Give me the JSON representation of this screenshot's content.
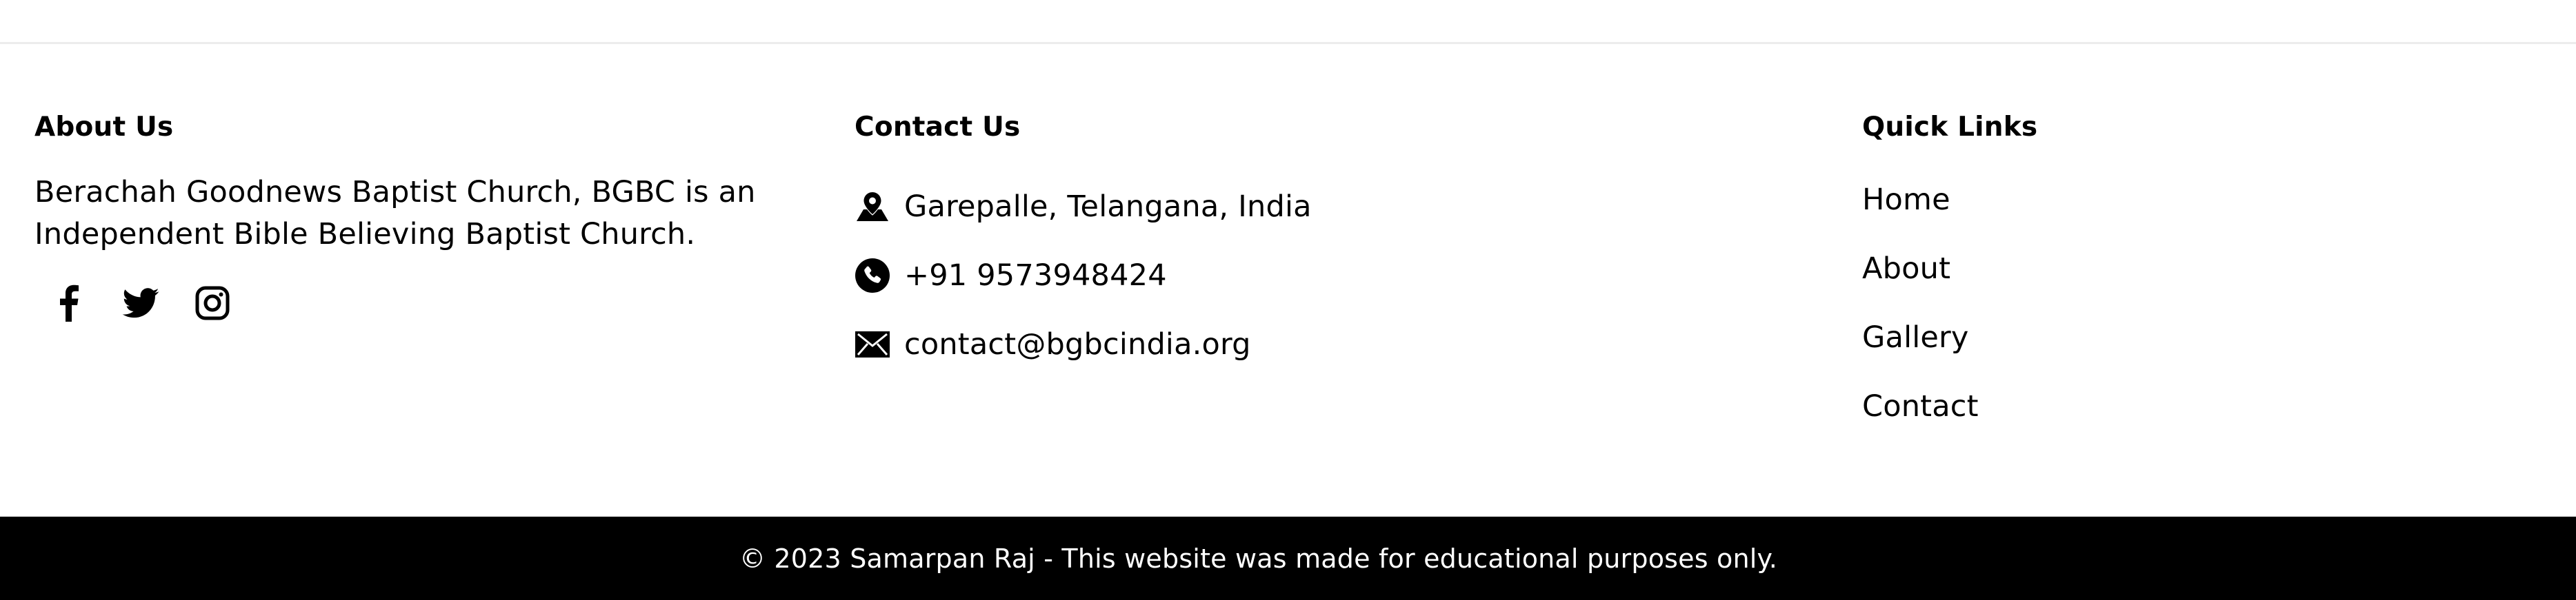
{
  "about": {
    "heading": "About Us",
    "text_line1": "Berachah Goodnews Baptist Church, BGBC is an",
    "text_line2": "Independent Bible Believing Baptist Church.",
    "social": [
      {
        "icon": "facebook-icon"
      },
      {
        "icon": "twitter-icon"
      },
      {
        "icon": "instagram-icon"
      }
    ]
  },
  "contact": {
    "heading": "Contact Us",
    "items": [
      {
        "icon": "location-pin-icon",
        "text": "Garepalle, Telangana, India"
      },
      {
        "icon": "phone-icon",
        "text": "+91 9573948424"
      },
      {
        "icon": "envelope-icon",
        "text": "contact@bgbcindia.org"
      }
    ]
  },
  "quick_links": {
    "heading": "Quick Links",
    "items": [
      "Home",
      "About",
      "Gallery",
      "Contact"
    ]
  },
  "footer": {
    "copyright": "© 2023 Samarpan Raj - This website was made for educational purposes only.",
    "background": "#000000",
    "text_color": "#ffffff"
  }
}
